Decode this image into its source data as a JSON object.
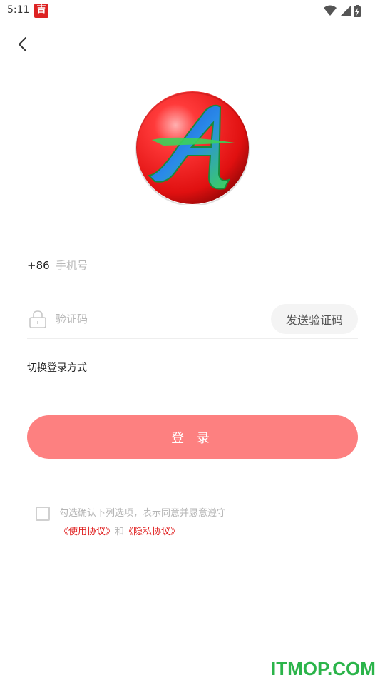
{
  "status_bar": {
    "time": "5:11",
    "badge_char": "吉",
    "icons": [
      "wifi-icon",
      "signal-icon",
      "battery-charging-icon"
    ]
  },
  "nav": {
    "back_icon": "chevron-left-icon"
  },
  "logo": {
    "letter": "A",
    "colors": {
      "circle": "#ee1c1c",
      "letter_fill": "#2a6fe0",
      "letter_accent": "#33cc55"
    }
  },
  "phone_field": {
    "country_code": "+86",
    "placeholder": "手机号",
    "value": ""
  },
  "code_field": {
    "icon": "lock-icon",
    "placeholder": "验证码",
    "value": "",
    "send_button_label": "发送验证码"
  },
  "switch_login_label": "切换登录方式",
  "login_button_label": "登 录",
  "agreement": {
    "checked": false,
    "text": "勾选确认下列选项，表示同意并愿意遵守",
    "terms_link": "《使用协议》",
    "conjunction": "和",
    "privacy_link": "《隐私协议》"
  },
  "watermark": "ITMOP.COM",
  "theme": {
    "accent": "#fd8080",
    "link": "#e02020",
    "placeholder": "#b8b8b8"
  }
}
